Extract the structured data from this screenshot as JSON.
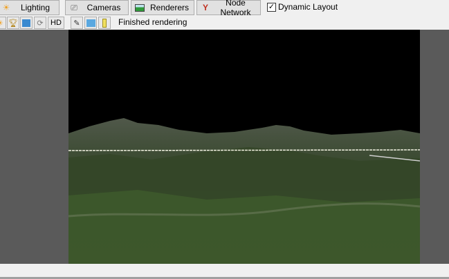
{
  "tabs": [
    {
      "label": "Lighting",
      "icon": "sun-icon"
    },
    {
      "label": "Cameras",
      "icon": "camera-icon"
    },
    {
      "label": "Renderers",
      "icon": "landscape-icon"
    },
    {
      "label": "Node Network",
      "icon": "node-network-icon"
    }
  ],
  "dynamic_layout": {
    "label": "Dynamic Layout",
    "checked": true
  },
  "toolbar": {
    "hd_label": "HD",
    "status": "Finished rendering"
  },
  "colors": {
    "viewport_bg": "#5a5a5a",
    "sky": "#000000",
    "terrain": "#3d4f2c"
  }
}
